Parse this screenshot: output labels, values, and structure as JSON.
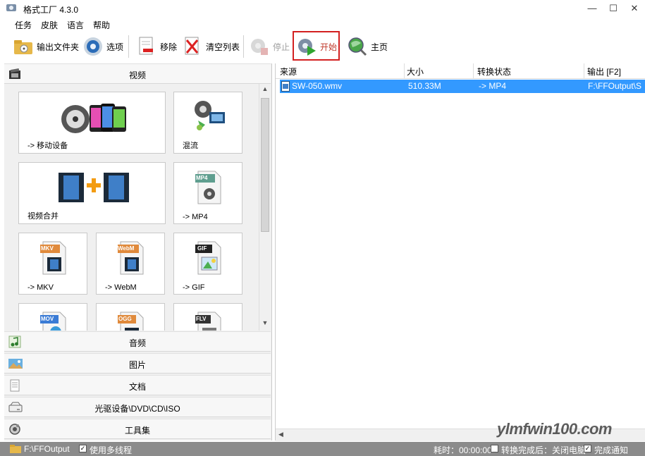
{
  "window": {
    "title": "格式工厂 4.3.0",
    "minimize": "—",
    "maximize": "☐",
    "close": "✕"
  },
  "menu": [
    "任务",
    "皮肤",
    "语言",
    "帮助"
  ],
  "toolbar": {
    "output_folder": "输出文件夹",
    "options": "选项",
    "remove": "移除",
    "clear_list": "清空列表",
    "stop": "停止",
    "start": "开始",
    "home": "主页"
  },
  "categories": {
    "video": "视频",
    "audio": "音频",
    "image": "图片",
    "document": "文档",
    "optical": "光驱设备\\DVD\\CD\\ISO",
    "tools": "工具集"
  },
  "tiles": {
    "mobile": "-> 移动设备",
    "mux": "混流",
    "join": "视频合并",
    "mp4": "-> MP4",
    "mkv": "-> MKV",
    "webm": "-> WebM",
    "gif": "-> GIF",
    "mkv_badge": "MKV",
    "webm_badge": "WebM",
    "gif_badge": "GIF",
    "mp4_badge": "MP4",
    "mov_badge": "MOV",
    "ogg_badge": "OGG",
    "flv_badge": "FLV"
  },
  "list": {
    "columns": [
      "来源",
      "大小",
      "转换状态",
      "输出 [F2]"
    ],
    "rows": [
      {
        "source": "SW-050.wmv",
        "size": "510.33M",
        "status": "-> MP4",
        "output": "F:\\FFOutput\\S"
      }
    ]
  },
  "statusbar": {
    "output_path": "F:\\FFOutput",
    "multithread": "使用多线程",
    "elapsed": "耗时：00:00:00",
    "after_convert": "转换完成后：关闭电脑",
    "notify": "完成通知"
  },
  "watermark": "ylmfwin100.com",
  "colors": {
    "selection": "#3399ff",
    "start_highlight": "#d32020",
    "statusbar": "#8b8b8b"
  }
}
